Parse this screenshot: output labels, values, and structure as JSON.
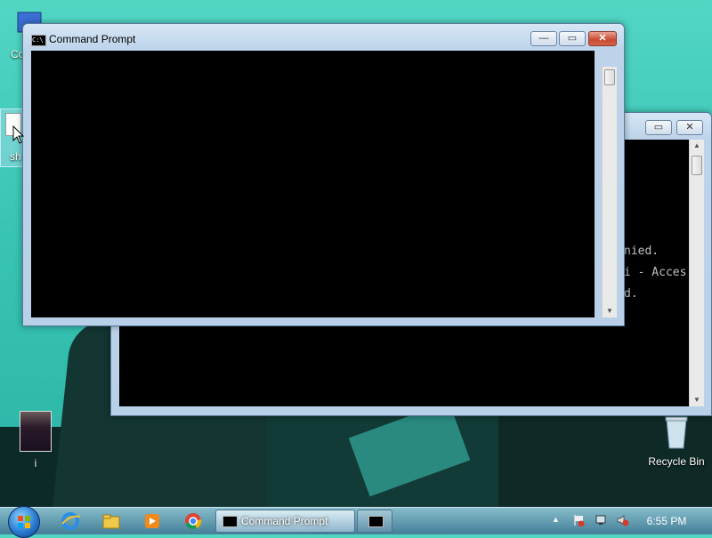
{
  "desktop": {
    "icons": [
      {
        "label": "Co"
      },
      {
        "label": "sh"
      },
      {
        "label": "i"
      },
      {
        "label": "Recycle Bin"
      }
    ]
  },
  "window_front": {
    "title": "Command Prompt",
    "console_lines": [
      "",
      "",
      "",
      ""
    ]
  },
  "window_back": {
    "title": "",
    "console_lines": [
      "nied.",
      "i - Acces",
      "d."
    ]
  },
  "window_controls": {
    "minimize": "—",
    "maximize": "▭",
    "close": "✕"
  },
  "taskbar": {
    "pinned": [
      {
        "name": "Internet Explorer",
        "icon": "ie-icon"
      },
      {
        "name": "Windows Explorer",
        "icon": "folder-icon"
      },
      {
        "name": "Windows Media Player",
        "icon": "media-player-icon"
      },
      {
        "name": "Google Chrome",
        "icon": "chrome-icon"
      }
    ],
    "tasks": [
      {
        "label": "Command Prompt",
        "active": true
      },
      {
        "label": "",
        "active": false
      }
    ],
    "clock": "6:55 PM"
  },
  "colors": {
    "console_bg": "#000000",
    "close_red": "#c94a32",
    "accent": "#2a7bd0"
  }
}
